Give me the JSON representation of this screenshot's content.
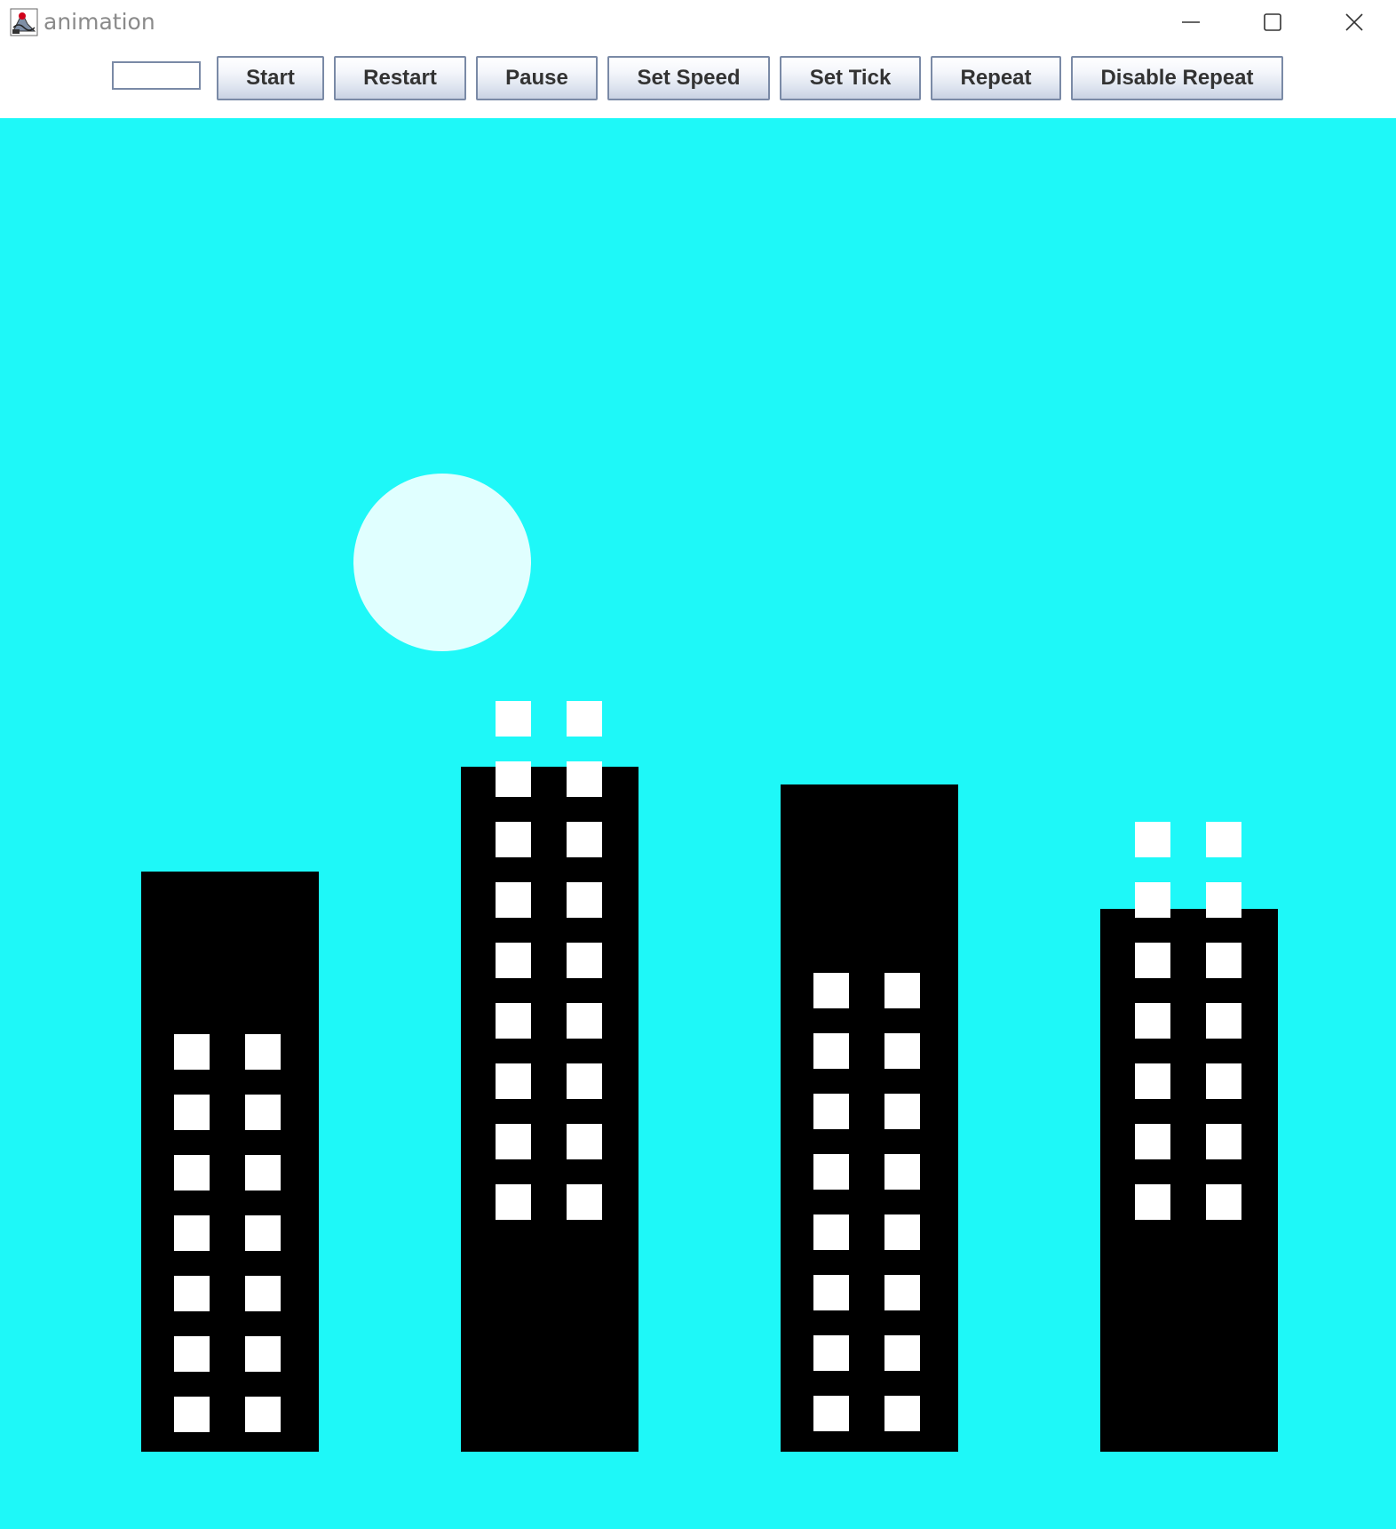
{
  "window": {
    "title": "animation",
    "controls": {
      "minimize_icon": "minimize-icon",
      "maximize_icon": "maximize-icon",
      "close_icon": "close-icon"
    }
  },
  "toolbar": {
    "input_value": "",
    "buttons": {
      "start": "Start",
      "restart": "Restart",
      "pause": "Pause",
      "set_speed": "Set Speed",
      "set_tick": "Set Tick",
      "repeat": "Repeat",
      "disable_repeat": "Disable Repeat"
    }
  },
  "scene": {
    "sky_color": "#1ef8f8",
    "moon_color": "#e0ffff",
    "building_color": "#000000",
    "window_color": "#ffffff",
    "building_count": 4
  }
}
